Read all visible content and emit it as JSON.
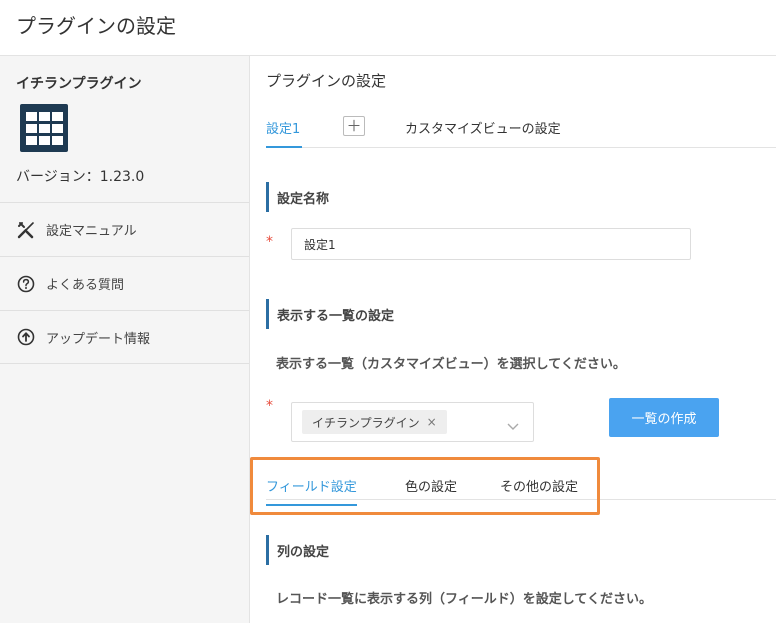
{
  "header": {
    "title": "プラグインの設定"
  },
  "sidebar": {
    "plugin_name": "イチランプラグイン",
    "plugin_icon": "grid-table-icon",
    "version": "バージョン：1.23.0",
    "items": [
      {
        "label": "設定マニュアル",
        "icon": "tools-icon"
      },
      {
        "label": "よくある質問",
        "icon": "question-circle-icon"
      },
      {
        "label": "アップデート情報",
        "icon": "arrow-up-circle-icon"
      }
    ]
  },
  "main": {
    "title": "プラグインの設定",
    "tabs": [
      {
        "label": "設定1",
        "active": true
      },
      {
        "label": "＋"
      },
      {
        "label": "カスタマイズビューの設定"
      }
    ],
    "setting_name": {
      "heading": "設定名称",
      "required_mark": "*",
      "value": "設定1"
    },
    "list_setting": {
      "heading": "表示する一覧の設定",
      "description": "表示する一覧（カスタマイズビュー）を選択してください。",
      "required_mark": "*",
      "selected": "イチランプラグイン",
      "remove": "×",
      "create_button": "一覧の作成"
    },
    "sub_tabs": [
      {
        "label": "フィールド設定",
        "active": true
      },
      {
        "label": "色の設定"
      },
      {
        "label": "その他の設定"
      }
    ],
    "column_setting": {
      "heading": "列の設定",
      "description": "レコード一覧に表示する列（フィールド）を設定してください。"
    }
  },
  "colors": {
    "accent": "#3498db",
    "button": "#4aa3f0",
    "highlight": "#f08a3c",
    "required": "#e74c3c",
    "icon_bg": "#1e3a52"
  }
}
